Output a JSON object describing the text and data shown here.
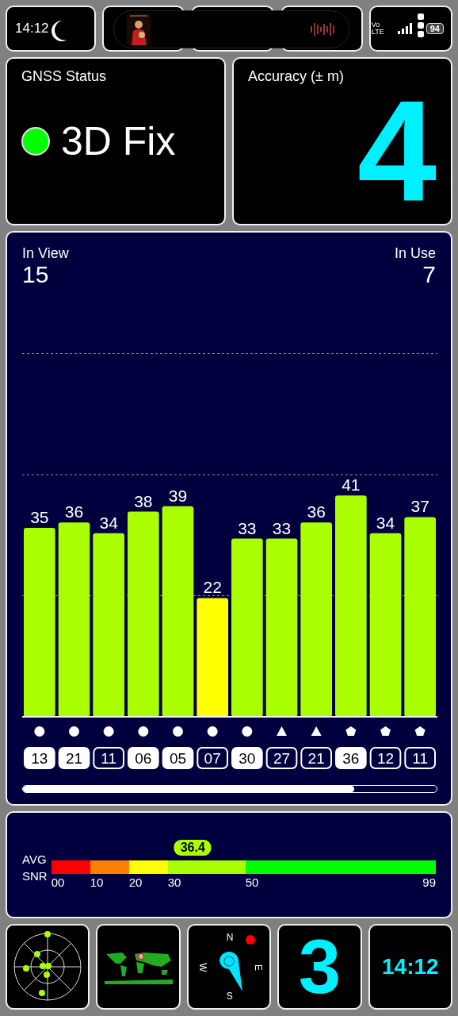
{
  "status_bar": {
    "time": "14:12",
    "network": [
      "Vo",
      "LTE"
    ],
    "battery": "94"
  },
  "gnss_status": {
    "label": "GNSS Status",
    "value": "3D Fix",
    "color": "#00ff00"
  },
  "accuracy": {
    "label": "Accuracy (± m)",
    "value": "4"
  },
  "in_view": {
    "label": "In View",
    "value": "15"
  },
  "in_use": {
    "label": "In Use",
    "value": "7"
  },
  "signal_chart": {
    "chart_data": {
      "type": "bar",
      "categories": [
        "13",
        "21",
        "11",
        "06",
        "05",
        "07",
        "30",
        "27",
        "21",
        "36",
        "12",
        "11"
      ],
      "values": [
        35,
        36,
        34,
        38,
        39,
        22,
        33,
        33,
        36,
        41,
        34,
        37
      ],
      "data_labels": true
    }
  },
  "satellites": [
    {
      "kind": "circle",
      "used": true
    },
    {
      "kind": "circle",
      "used": true
    },
    {
      "kind": "circle",
      "used": false
    },
    {
      "kind": "circle",
      "used": true
    },
    {
      "kind": "circle",
      "used": true
    },
    {
      "kind": "circle",
      "used": false
    },
    {
      "kind": "circle",
      "used": true
    },
    {
      "kind": "triangle",
      "used": false
    },
    {
      "kind": "triangle",
      "used": false
    },
    {
      "kind": "pentagon",
      "used": true
    },
    {
      "kind": "pentagon",
      "used": false
    },
    {
      "kind": "pentagon",
      "used": false
    }
  ],
  "avg_snr": {
    "label": [
      "AVG",
      "SNR"
    ],
    "value": "36.4",
    "level": 0.368,
    "scale": [
      {
        "label": "00",
        "color": "#ff0000"
      },
      {
        "label": "10",
        "color": "#ff8000"
      },
      {
        "label": "20",
        "color": "#ffff00"
      },
      {
        "label": "30",
        "color": "#aaff00"
      },
      {
        "label": "50",
        "color": "#00ff00"
      },
      {
        "label": "99"
      }
    ]
  },
  "compass": {
    "north": "N",
    "east": "E",
    "south": "S",
    "west": "W"
  },
  "fix_count": "3",
  "clock": "14:12"
}
